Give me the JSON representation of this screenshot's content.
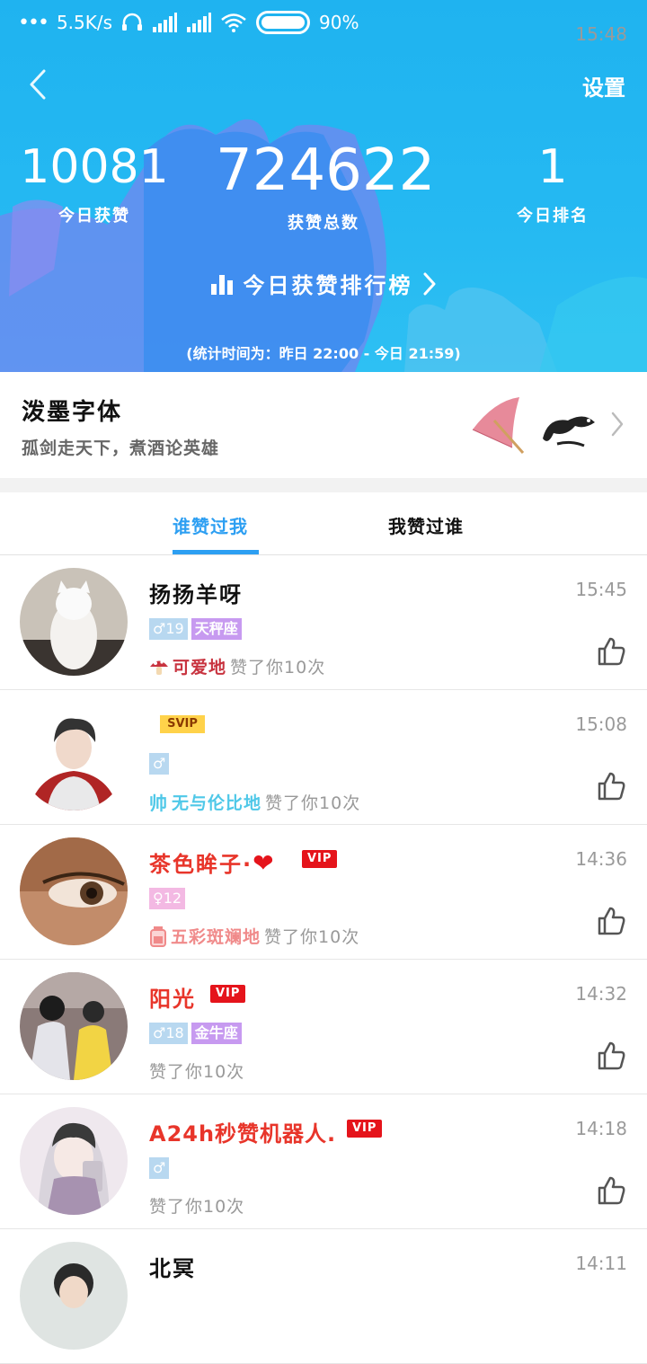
{
  "status_bar": {
    "time": "15:48",
    "network_speed": "5.5K/s",
    "battery": "90%",
    "icons": [
      "more-dots-icon",
      "headset-icon",
      "signal-icon",
      "signal-icon",
      "wifi-icon",
      "battery-icon"
    ]
  },
  "header": {
    "settings_label": "设置",
    "today_likes": "10081",
    "today_likes_label": "今日获赞",
    "total_likes": "724622",
    "total_likes_label": "获赞总数",
    "today_rank": "1",
    "today_rank_label": "今日排名",
    "rank_link_label": "今日获赞排行榜",
    "stat_time": "(统计时间为：昨日 22:00 - 今日 21:59)"
  },
  "font_banner": {
    "title": "泼墨字体",
    "subtitle": "孤剑走天下，煮酒论英雄"
  },
  "tabs": [
    {
      "label": "谁赞过我",
      "active": true
    },
    {
      "label": "我赞过谁",
      "active": false
    }
  ],
  "likes": [
    {
      "name": "扬扬羊呀",
      "name_color": "#111111",
      "time": "15:45",
      "gender": "male",
      "age": "19",
      "zodiac": "天秤座",
      "badge": "",
      "decor_icon": "mushroom-icon",
      "decor_text": "可爱地",
      "decor_color": "#c8333f",
      "liked_text": "赞了你10次"
    },
    {
      "name": "",
      "name_color": "#111111",
      "time": "15:08",
      "gender": "male",
      "age": "",
      "zodiac": "",
      "badge": "SVIP",
      "decor_icon": "handsome-icon",
      "decor_text": "无与伦比地",
      "decor_color": "#4fc8e8",
      "liked_text": "赞了你10次"
    },
    {
      "name": "茶色眸子·",
      "name_color": "#e8352a",
      "time": "14:36",
      "gender": "female",
      "age": "12",
      "zodiac": "",
      "badge": "VIP",
      "decor_icon": "jar-icon",
      "decor_text": "五彩斑斓地",
      "decor_color": "#f08a8a",
      "liked_text": "赞了你10次"
    },
    {
      "name": "阳光",
      "name_color": "#e8352a",
      "time": "14:32",
      "gender": "male",
      "age": "18",
      "zodiac": "金牛座",
      "badge": "VIP",
      "decor_icon": "",
      "decor_text": "",
      "decor_color": "",
      "liked_text": "赞了你10次"
    },
    {
      "name": "A24h秒赞机器人.",
      "name_color": "#e8352a",
      "time": "14:18",
      "gender": "male",
      "age": "",
      "zodiac": "",
      "badge": "VIP",
      "decor_icon": "",
      "decor_text": "",
      "decor_color": "",
      "liked_text": "赞了你10次"
    },
    {
      "name": "北冥",
      "name_color": "#111111",
      "time": "14:11",
      "gender": "",
      "age": "",
      "zodiac": "",
      "badge": "",
      "decor_icon": "",
      "decor_text": "",
      "decor_color": "",
      "liked_text": ""
    }
  ],
  "colors": {
    "accent": "#2d9ff2",
    "hero_bg": "#22b6f2",
    "vip_red": "#e5141b"
  }
}
